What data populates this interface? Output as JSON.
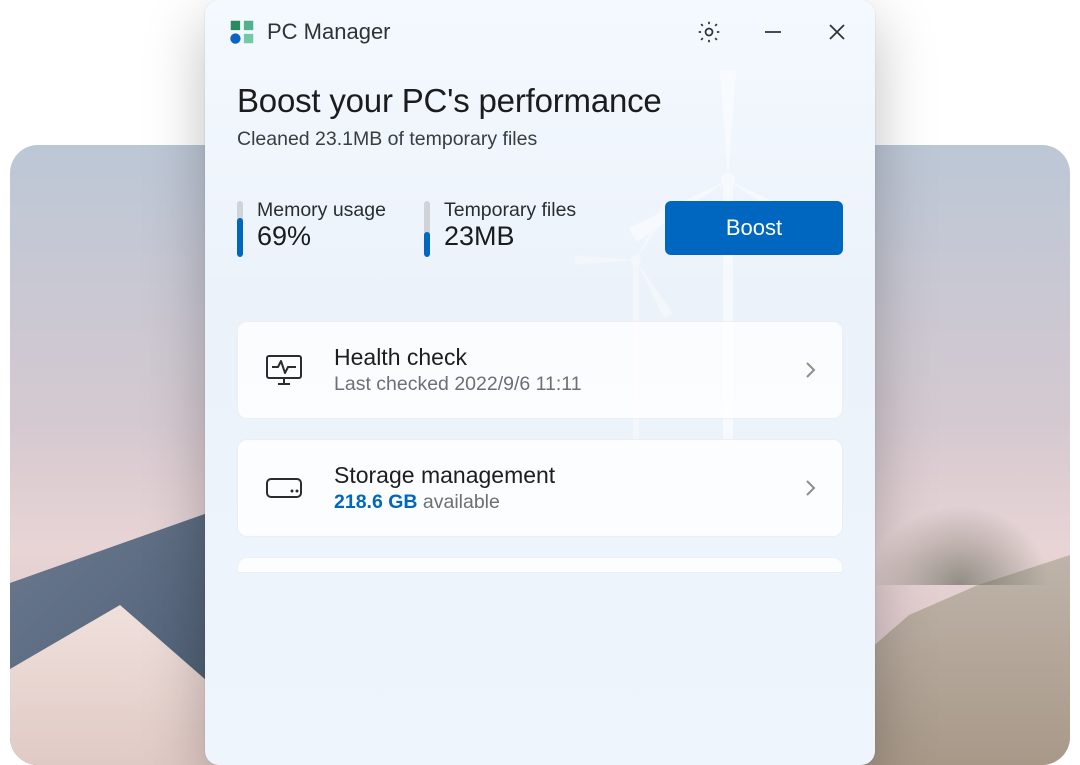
{
  "app": {
    "title": "PC Manager"
  },
  "hero": {
    "headline": "Boost your PC's performance",
    "subhead": "Cleaned 23.1MB of temporary files"
  },
  "stats": {
    "memory": {
      "label": "Memory usage",
      "value": "69%",
      "fill_percent": 69
    },
    "temp": {
      "label": "Temporary files",
      "value": "23MB",
      "fill_percent": 45
    }
  },
  "boost": {
    "label": "Boost"
  },
  "cards": {
    "health": {
      "title": "Health check",
      "subtitle": "Last checked 2022/9/6 11:11"
    },
    "storage": {
      "title": "Storage management",
      "available_value": "218.6 GB",
      "available_suffix": " available"
    }
  },
  "icons": {
    "settings": "gear-icon",
    "minimize": "minimize-icon",
    "close": "close-icon"
  }
}
